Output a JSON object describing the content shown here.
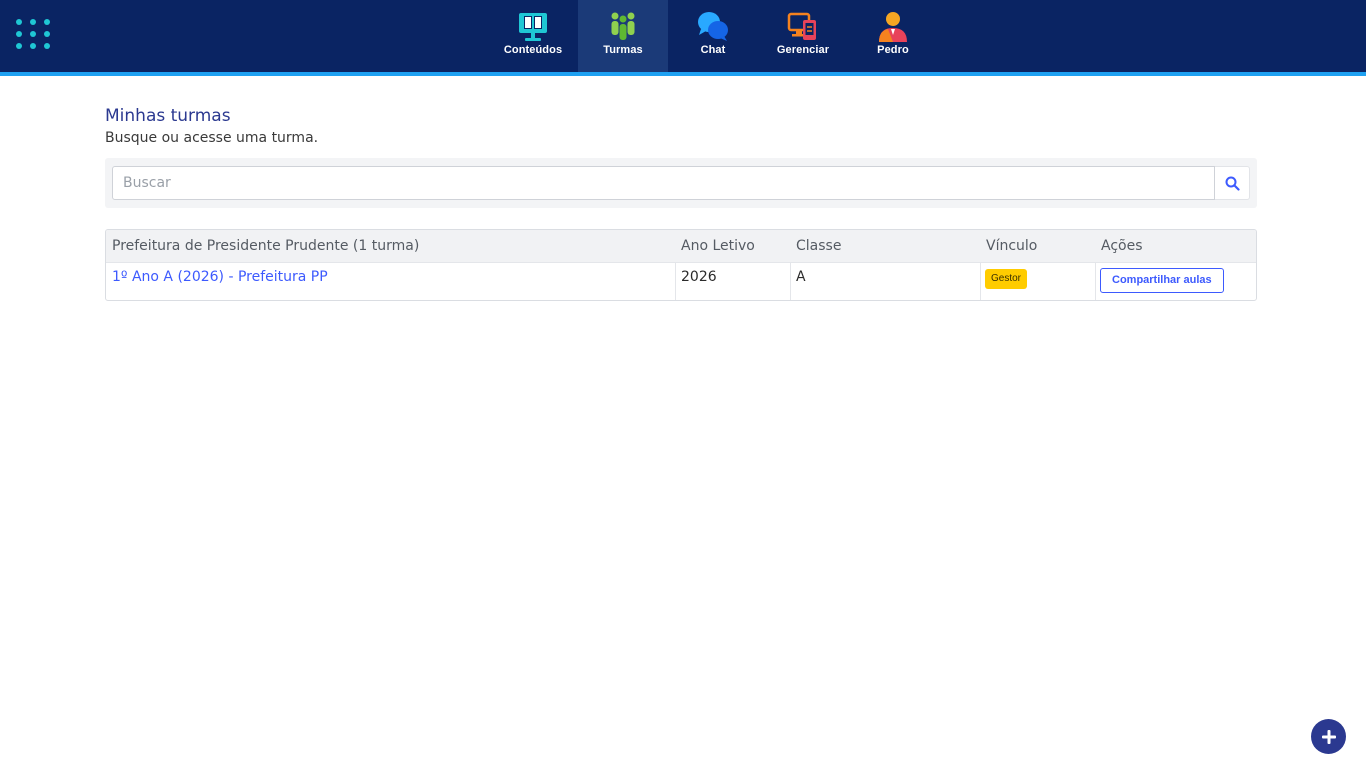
{
  "colors": {
    "navbar": "#0a2463",
    "navbar_active": "#1b3a78",
    "accent_bar": "#1ea1f2",
    "title": "#2b3990",
    "link": "#3d5afe",
    "badge": "#ffcc00",
    "fab": "#2b3990"
  },
  "topbar": {
    "apps_icon": "apps-grid-icon",
    "nav": [
      {
        "label": "Conteúdos",
        "icon": "monitor-book-icon",
        "active": false
      },
      {
        "label": "Turmas",
        "icon": "people-group-icon",
        "active": true
      },
      {
        "label": "Chat",
        "icon": "chat-bubbles-icon",
        "active": false
      },
      {
        "label": "Gerenciar",
        "icon": "manage-devices-icon",
        "active": false
      },
      {
        "label": "Pedro",
        "icon": "user-avatar-icon",
        "active": false
      }
    ]
  },
  "page": {
    "title": "Minhas turmas",
    "subtitle": "Busque ou acesse uma turma."
  },
  "search": {
    "placeholder": "Buscar",
    "value": "",
    "icon": "search-icon"
  },
  "table": {
    "headers": [
      "Prefeitura de Presidente Prudente (1 turma)",
      "Ano Letivo",
      "Classe",
      "Vínculo",
      "Ações"
    ],
    "rows": [
      {
        "turma": "1º Ano A (2026) - Prefeitura PP",
        "ano_letivo": "2026",
        "classe": "A",
        "vinculo": "Gestor",
        "acao": "Compartilhar aulas"
      }
    ]
  },
  "fab": {
    "icon": "plus-icon"
  }
}
